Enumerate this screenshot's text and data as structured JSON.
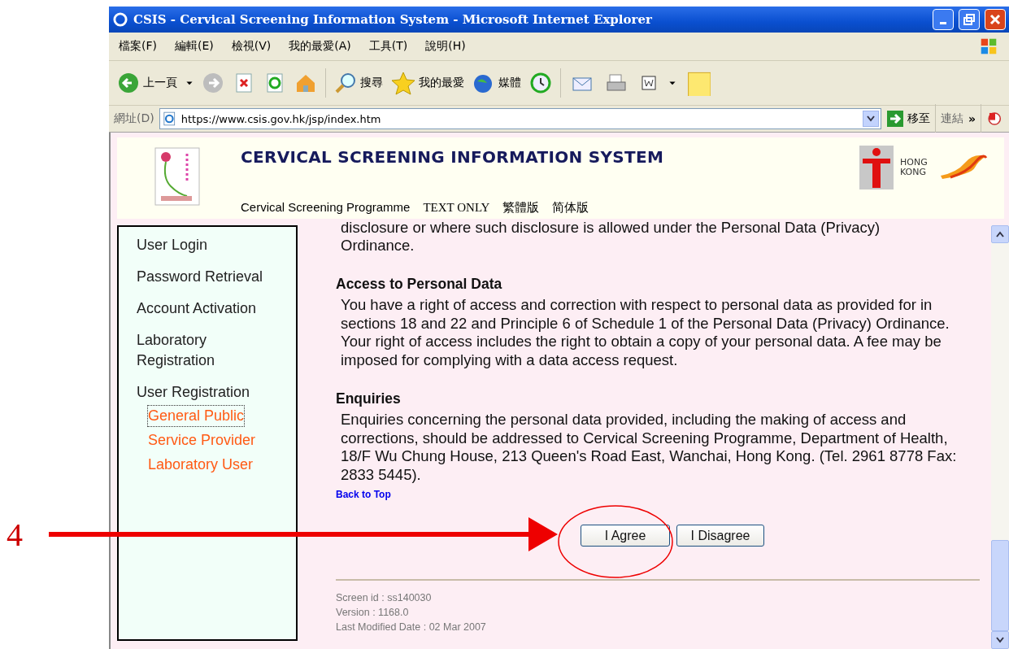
{
  "window": {
    "title": "CSIS - Cervical Screening Information System - Microsoft Internet Explorer"
  },
  "menu": [
    "檔案(F)",
    "編輯(E)",
    "檢視(V)",
    "我的最愛(A)",
    "工具(T)",
    "說明(H)"
  ],
  "toolbar": {
    "back": "上一頁",
    "search": "搜尋",
    "favorites": "我的最愛",
    "media": "媒體"
  },
  "address_bar": {
    "label": "網址(D)",
    "url": "https://www.csis.gov.hk/jsp/index.htm",
    "go": "移至",
    "links": "連結",
    "more": "»"
  },
  "header": {
    "title": "CERVICAL SCREENING INFORMATION SYSTEM",
    "logo_text": "HONG KONG",
    "links": [
      "Cervical Screening Programme",
      "TEXT ONLY",
      "繁體版",
      "简体版"
    ]
  },
  "sidebar": {
    "items": [
      {
        "label": "User Login"
      },
      {
        "label": "Password Retrieval"
      },
      {
        "label": "Account Activation"
      },
      {
        "label": "Laboratory Registration"
      },
      {
        "label": "User Registration",
        "children": [
          {
            "label": "General Public",
            "selected": true
          },
          {
            "label": "Service Provider",
            "selected": false
          },
          {
            "label": "Laboratory User",
            "selected": false
          }
        ]
      }
    ]
  },
  "content": {
    "lead_lines": [
      "disclosure or where such disclosure is allowed under the Personal Data (Privacy)",
      "Ordinance."
    ],
    "sections": [
      {
        "heading": "Access to Personal Data",
        "body": "You have a right of access and correction with respect to personal data as provided for in sections 18 and 22 and Principle 6 of Schedule 1 of the Personal Data (Privacy) Ordinance. Your right of access includes the right to obtain a copy of your personal data. A fee may be imposed for complying with a data access request."
      },
      {
        "heading": "Enquiries",
        "body": "Enquiries concerning the personal data provided, including the making of access and corrections, should be addressed to Cervical Screening Programme, Department of Health, 18/F Wu Chung House, 213 Queen's Road East, Wanchai, Hong Kong. (Tel. 2961 8778 Fax: 2833 5445)."
      }
    ],
    "back_to_top": "Back to Top",
    "buttons": [
      "I Agree",
      "I Disagree"
    ],
    "footer": [
      "Screen id : ss140030",
      "Version : 1168.0",
      "Last Modified Date : 02 Mar 2007"
    ]
  },
  "annotation": {
    "number": "4"
  }
}
